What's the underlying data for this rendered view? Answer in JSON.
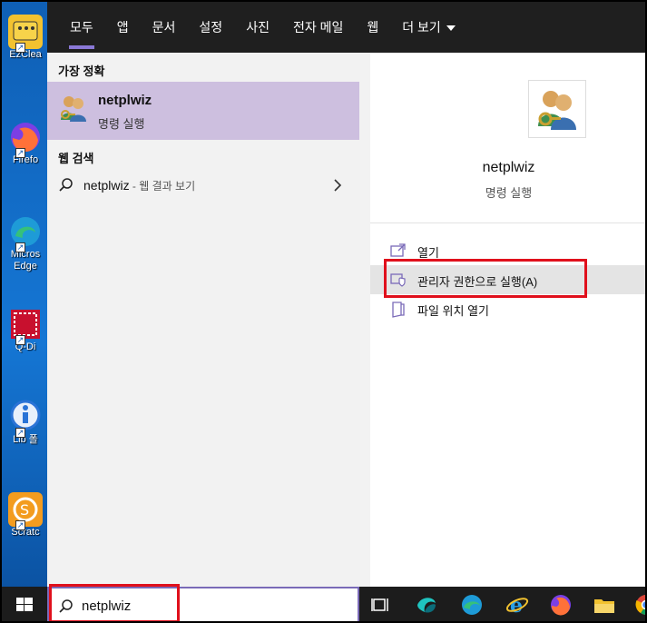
{
  "desktop": {
    "icons": [
      {
        "label": "EzClea",
        "icon": "ezclean-icon",
        "color": "#f2c230"
      },
      {
        "label": "Firefo",
        "icon": "firefox-icon",
        "color": "#e8612a"
      },
      {
        "label": "Micros Edge",
        "icon": "edge-icon",
        "color": "#1e9bd7"
      },
      {
        "label": "Q-Di",
        "icon": "qdir-icon",
        "color": "#c8102e"
      },
      {
        "label": "Lib 폴",
        "icon": "info-icon",
        "color": "#2a73d6"
      },
      {
        "label": "Scratc",
        "icon": "scratch-icon",
        "color": "#f39c1f"
      }
    ]
  },
  "tabs": [
    {
      "label": "모두",
      "active": true
    },
    {
      "label": "앱"
    },
    {
      "label": "문서"
    },
    {
      "label": "설정"
    },
    {
      "label": "사진"
    },
    {
      "label": "전자 메일"
    },
    {
      "label": "웹"
    },
    {
      "label": "더 보기",
      "dropdown": true
    }
  ],
  "results": {
    "best_match_header": "가장 정확",
    "best_match": {
      "title": "netplwiz",
      "subtitle": "명령 실행"
    },
    "web_header": "웹 검색",
    "web_item": {
      "query": "netplwiz",
      "suffix": " - 웹 결과 보기"
    }
  },
  "detail": {
    "title": "netplwiz",
    "subtitle": "명령 실행",
    "actions": [
      {
        "label": "열기",
        "icon": "open-icon"
      },
      {
        "label": "관리자 권한으로 실행(A)",
        "icon": "shield-icon",
        "highlighted": true
      },
      {
        "label": "파일 위치 열기",
        "icon": "file-location-icon"
      }
    ]
  },
  "search": {
    "value": "netplwiz"
  },
  "taskbar": {
    "icons": [
      "task-view-icon",
      "app-icon",
      "edge-icon",
      "ie-icon",
      "firefox-icon",
      "file-explorer-icon",
      "chrome-icon"
    ]
  },
  "colors": {
    "accent": "#8a78d6",
    "highlight": "#e0101c",
    "selected": "#cdbfdf"
  }
}
